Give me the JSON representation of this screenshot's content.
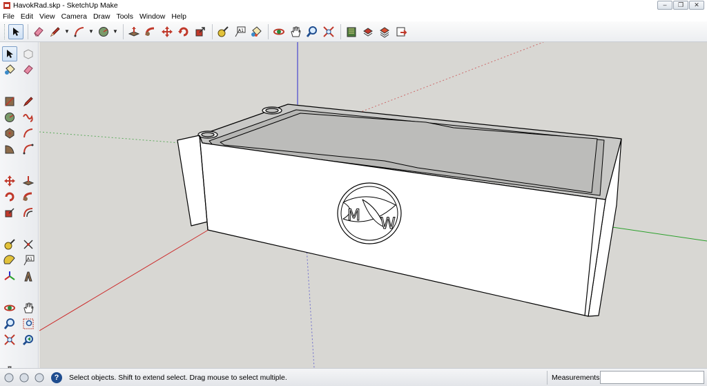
{
  "window": {
    "title": "HavokRad.skp - SketchUp Make",
    "minimize_label": "–",
    "maximize_label": "❐",
    "close_label": "✕"
  },
  "menubar": {
    "items": [
      "File",
      "Edit",
      "View",
      "Camera",
      "Draw",
      "Tools",
      "Window",
      "Help"
    ]
  },
  "viewport": {
    "background": "#d8d7d3",
    "logo_letters": [
      "M",
      "W"
    ],
    "axis_colors": {
      "red": "#cc2a2a",
      "green": "#2aa02a",
      "blue": "#2a2acc"
    }
  },
  "statusbar": {
    "help_label": "?",
    "message": "Select objects. Shift to extend select. Drag mouse to select multiple.",
    "measurements_label": "Measurements",
    "measurements_value": ""
  },
  "icons": {
    "top_toolbar": [
      "select-icon",
      "eraser-icon",
      "pencil-icon",
      "arc-icon",
      "circle-icon",
      "push-pull-icon",
      "follow-me-icon",
      "move-icon",
      "rotate-icon",
      "scale-icon",
      "tape-measure-icon",
      "text-icon",
      "paint-bucket-icon",
      "orbit-icon",
      "pan-icon",
      "zoom-icon",
      "zoom-extents-icon",
      "3d-warehouse-icon",
      "share-model-icon",
      "get-models-icon",
      "extension-warehouse-icon"
    ],
    "left_toolbar": [
      "select-icon",
      "component-icon",
      "paint-bucket-icon",
      "eraser-icon",
      "rectangle-icon",
      "line-icon",
      "circle-icon",
      "freehand-icon",
      "polygon-icon",
      "arc-icon",
      "pie-icon",
      "arc-3pt-icon",
      "move-icon",
      "push-pull-icon",
      "rotate-icon",
      "follow-me-icon",
      "scale-icon",
      "offset-icon",
      "tape-measure-icon",
      "dimension-icon",
      "protractor-icon",
      "text-icon",
      "axes-icon",
      "3d-text-icon",
      "orbit-icon",
      "pan-icon",
      "zoom-icon",
      "zoom-window-icon",
      "zoom-extents-icon",
      "previous-view-icon",
      "position-camera-icon",
      "look-around-icon",
      "walk-icon",
      "section-plane-icon"
    ]
  }
}
